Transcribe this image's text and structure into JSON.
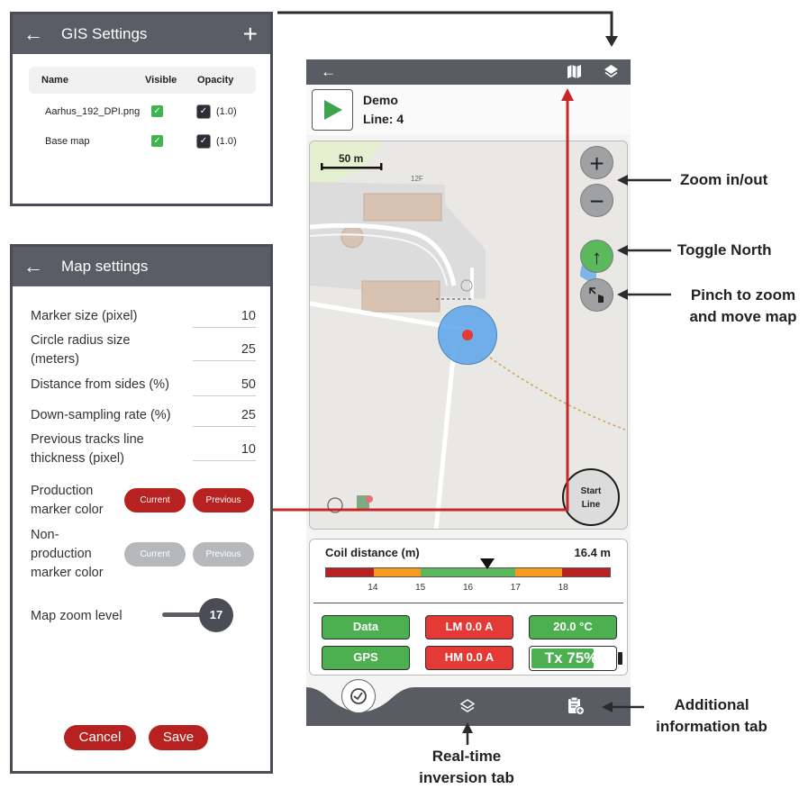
{
  "gis": {
    "title": "GIS Settings",
    "back_icon": "←",
    "add_icon": "+",
    "columns": {
      "name": "Name",
      "visible": "Visible",
      "opacity": "Opacity"
    },
    "rows": [
      {
        "name": "Aarhus_192_DPI.png",
        "opacity": "(1.0)"
      },
      {
        "name": "Base map",
        "opacity": "(1.0)"
      }
    ]
  },
  "map_settings": {
    "title": "Map settings",
    "back_icon": "←",
    "fields": [
      {
        "label": "Marker size (pixel)",
        "value": "10"
      },
      {
        "label": "Circle radius size (meters)",
        "value": "25"
      },
      {
        "label": "Distance from sides (%)",
        "value": "50"
      },
      {
        "label": "Down-sampling rate (%)",
        "value": "25"
      },
      {
        "label": "Previous tracks line thickness (pixel)",
        "value": "10"
      }
    ],
    "production_label": "Production marker color",
    "non_production_label": "Non-production marker color",
    "current_label": "Current",
    "previous_label": "Previous",
    "zoom_label": "Map zoom level",
    "zoom_value": "17",
    "cancel_label": "Cancel",
    "save_label": "Save"
  },
  "phone": {
    "back_icon": "←",
    "job_name": "Demo",
    "line_label": "Line: 4",
    "map": {
      "scale_label": "50 m",
      "building_label": "12F",
      "zoom_in": "+",
      "zoom_out": "−",
      "north_icon": "↑",
      "start_line": "Start Line"
    },
    "coil": {
      "label": "Coil distance (m)",
      "value": "16.4 m",
      "value_num": 16.4,
      "ticks": [
        "14",
        "15",
        "16",
        "17",
        "18"
      ]
    },
    "status": {
      "data": "Data",
      "lm": "LM 0.0 A",
      "temp": "20.0 °C",
      "gps": "GPS",
      "hm": "HM 0.0 A",
      "tx": "Tx 75%",
      "tx_level": 0.75
    }
  },
  "annotations": {
    "zoom": "Zoom in/out",
    "north": "Toggle North",
    "pinch": "Pinch to zoom and move map",
    "additional": "Additional information tab",
    "realtime": "Real-time inversion tab"
  },
  "colors": {
    "header": "#5a5d65",
    "accent_red": "#b7211f",
    "status_green": "#4caf50",
    "status_red": "#e53935",
    "route_red": "#c62828",
    "marker_blue": "#64a8ea"
  }
}
